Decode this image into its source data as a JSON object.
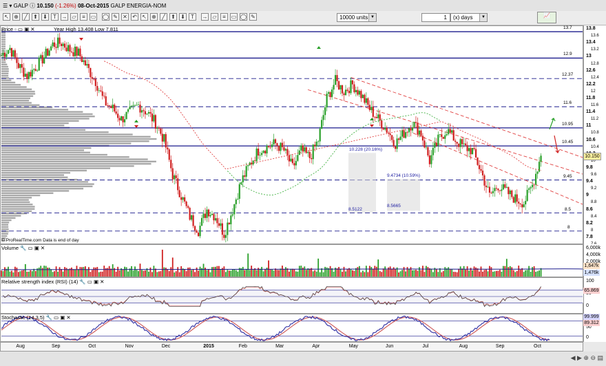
{
  "header": {
    "title": "GALP",
    "price": "10.150",
    "change": "(-1.26%)",
    "date": "08-Oct-2015",
    "name": "GALP ENERGIA-NOM"
  },
  "toolbar": {
    "units": "10000 units",
    "interval_value": "1",
    "interval_unit": "(x) days"
  },
  "price_panel": {
    "label": "Price",
    "year_hilo": "Year High 13.408 Low 7.811",
    "source": "© ProRealTime.com  Data is end of day",
    "y_ticks": [
      "13.8",
      "13.4",
      "13",
      "12.6",
      "12.2",
      "11.8",
      "11.4",
      "11",
      "10.6",
      "10.2",
      "9.8",
      "9.4",
      "9",
      "8.6",
      "8.2",
      "7.8"
    ],
    "y_ticks_minor": [
      "13.6",
      "13.2",
      "12.8",
      "12.4",
      "12",
      "11.6",
      "11.2",
      "10.8",
      "10.4",
      "10",
      "9.6",
      "9.2",
      "8.8",
      "8.4",
      "8",
      "7.6"
    ],
    "current": "10.150",
    "levels": [
      {
        "label": "13.7",
        "value": 13.72,
        "style": "solid"
      },
      {
        "label": "12.9",
        "value": 12.96,
        "style": "solid"
      },
      {
        "label": "12.37",
        "value": 12.37,
        "style": "dash"
      },
      {
        "label": "11.6",
        "value": 11.56,
        "style": "dash"
      },
      {
        "label": "10.95",
        "value": 10.95,
        "style": "solid"
      },
      {
        "label": "10.45",
        "value": 10.43,
        "style": "solid"
      },
      {
        "label": "9.45",
        "value": 9.45,
        "style": "dash"
      },
      {
        "label": "8.5",
        "value": 8.5,
        "style": "dash"
      },
      {
        "label": "8",
        "value": 7.98,
        "style": "dash"
      }
    ],
    "annotations": [
      {
        "text": "10.228 (20.16%)"
      },
      {
        "text": "9.4734 (10.59%)"
      },
      {
        "text": "8.5122"
      },
      {
        "text": "8.5665"
      }
    ]
  },
  "volume_panel": {
    "label": "Volume",
    "y_ticks": [
      "6,000k",
      "4,000k",
      "2,000k"
    ],
    "tags": [
      "1,647k",
      "1,476k"
    ]
  },
  "rsi_panel": {
    "label": "Relative strength index (RSI) (14)",
    "y_ticks": [
      "100",
      "50",
      "0"
    ],
    "tag": "65.869"
  },
  "stoch_panel": {
    "label": "Stochastic (14,3,5)",
    "y_ticks": [
      "100",
      "50",
      "0"
    ],
    "tags": [
      "99.999",
      "89.312"
    ]
  },
  "x_axis": {
    "labels": [
      "Aug",
      "Sep",
      "Oct",
      "Nov",
      "Dec",
      "2015",
      "Feb",
      "Mar",
      "Apr",
      "May",
      "Jun",
      "Jul",
      "Aug",
      "Sep",
      "Oct"
    ]
  },
  "chart_data": {
    "type": "candlestick",
    "title": "GALP ENERGIA-NOM",
    "ylim": [
      7.6,
      13.9
    ],
    "x_start": "2014-07-21",
    "x_end": "2015-10-12",
    "series": [
      {
        "name": "Price",
        "points": [
          [
            "2014-07-21",
            13.05
          ],
          [
            "2014-07-28",
            13.25
          ],
          [
            "2014-08-04",
            12.75
          ],
          [
            "2014-08-11",
            12.45
          ],
          [
            "2014-08-18",
            12.7
          ],
          [
            "2014-08-25",
            13.0
          ],
          [
            "2014-09-01",
            13.35
          ],
          [
            "2014-09-08",
            13.4
          ],
          [
            "2014-09-15",
            13.2
          ],
          [
            "2014-09-22",
            13.1
          ],
          [
            "2014-09-29",
            12.7
          ],
          [
            "2014-10-06",
            12.3
          ],
          [
            "2014-10-13",
            11.7
          ],
          [
            "2014-10-20",
            11.5
          ],
          [
            "2014-10-27",
            11.2
          ],
          [
            "2014-11-03",
            11.4
          ],
          [
            "2014-11-10",
            11.6
          ],
          [
            "2014-11-17",
            11.4
          ],
          [
            "2014-11-24",
            11.1
          ],
          [
            "2014-12-01",
            10.6
          ],
          [
            "2014-12-08",
            9.6
          ],
          [
            "2014-12-15",
            9.0
          ],
          [
            "2014-12-22",
            8.4
          ],
          [
            "2014-12-29",
            8.0
          ],
          [
            "2015-01-05",
            8.6
          ],
          [
            "2015-01-12",
            8.4
          ],
          [
            "2015-01-19",
            7.9
          ],
          [
            "2015-01-26",
            8.6
          ],
          [
            "2015-02-02",
            9.4
          ],
          [
            "2015-02-09",
            9.9
          ],
          [
            "2015-02-16",
            10.3
          ],
          [
            "2015-02-23",
            10.4
          ],
          [
            "2015-03-02",
            10.5
          ],
          [
            "2015-03-09",
            10.3
          ],
          [
            "2015-03-16",
            9.8
          ],
          [
            "2015-03-23",
            10.3
          ],
          [
            "2015-03-30",
            10.1
          ],
          [
            "2015-04-06",
            10.6
          ],
          [
            "2015-04-13",
            11.8
          ],
          [
            "2015-04-20",
            12.3
          ],
          [
            "2015-04-27",
            12.0
          ],
          [
            "2015-05-04",
            12.2
          ],
          [
            "2015-05-11",
            11.9
          ],
          [
            "2015-05-18",
            11.5
          ],
          [
            "2015-05-25",
            11.2
          ],
          [
            "2015-06-01",
            10.9
          ],
          [
            "2015-06-08",
            10.5
          ],
          [
            "2015-06-15",
            10.8
          ],
          [
            "2015-06-22",
            11.1
          ],
          [
            "2015-06-29",
            10.8
          ],
          [
            "2015-07-06",
            10.0
          ],
          [
            "2015-07-13",
            10.6
          ],
          [
            "2015-07-20",
            10.9
          ],
          [
            "2015-07-27",
            10.6
          ],
          [
            "2015-08-03",
            10.4
          ],
          [
            "2015-08-10",
            10.3
          ],
          [
            "2015-08-17",
            9.7
          ],
          [
            "2015-08-24",
            9.0
          ],
          [
            "2015-08-31",
            9.3
          ],
          [
            "2015-09-07",
            9.1
          ],
          [
            "2015-09-14",
            8.9
          ],
          [
            "2015-09-21",
            8.8
          ],
          [
            "2015-09-28",
            9.3
          ],
          [
            "2015-10-05",
            10.15
          ]
        ]
      }
    ]
  },
  "colors": {
    "up": "#2aa02a",
    "down": "#d02020",
    "level_line": "#1a1a8c",
    "sma_red": "#e04040",
    "sma_green": "#40b040",
    "profile": "#a8a8a8",
    "channel": "#e04040"
  }
}
